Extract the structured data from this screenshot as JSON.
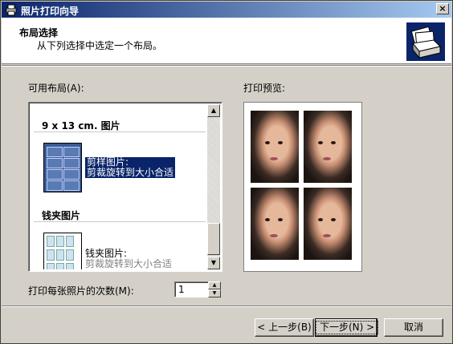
{
  "window": {
    "title": "照片打印向导",
    "close_label": "×"
  },
  "header": {
    "title": "布局选择",
    "subtitle": "从下列选择中选定一个布局。"
  },
  "layouts": {
    "label": "可用布局(A):",
    "groups": [
      {
        "name": "9 x 13 cm. 图片",
        "items": [
          {
            "title": "剪样图片:",
            "desc": "剪裁旋转到大小合适",
            "selected": true
          }
        ]
      },
      {
        "name": "钱夹图片",
        "items": [
          {
            "title": "钱夹图片:",
            "desc": "剪裁旋转到大小合适",
            "selected": false
          }
        ]
      }
    ]
  },
  "preview": {
    "label": "打印预览:"
  },
  "copies": {
    "label": "打印每张照片的次数(M):",
    "value": "1"
  },
  "buttons": {
    "back": "< 上一步(B)",
    "next": "下一步(N) >",
    "cancel": "取消"
  }
}
